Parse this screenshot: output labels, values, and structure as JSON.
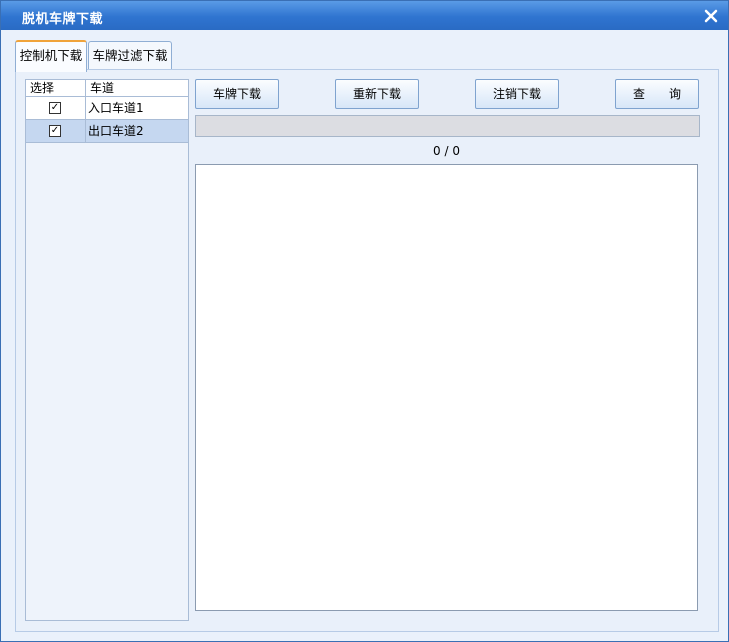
{
  "window": {
    "title": "脱机车牌下载"
  },
  "tabs": [
    {
      "label": "控制机下载",
      "active": true
    },
    {
      "label": "车牌过滤下载",
      "active": false
    }
  ],
  "lane_table": {
    "headers": {
      "select": "选择",
      "lane": "车道"
    },
    "rows": [
      {
        "checked": true,
        "check_mark": "✓",
        "name": "入口车道1",
        "selected": false
      },
      {
        "checked": true,
        "check_mark": "✓",
        "name": "出口车道2",
        "selected": true
      }
    ]
  },
  "toolbar": {
    "plate_download": "车牌下载",
    "re_download": "重新下载",
    "cancel_download": "注销下载",
    "query": "查　　询"
  },
  "progress": {
    "value": 0,
    "counter_text": "0 / 0"
  },
  "colors": {
    "titlebar": "#2f74d0",
    "selected_row": "#c5d7f0"
  },
  "icons": {
    "close": "close-icon"
  }
}
